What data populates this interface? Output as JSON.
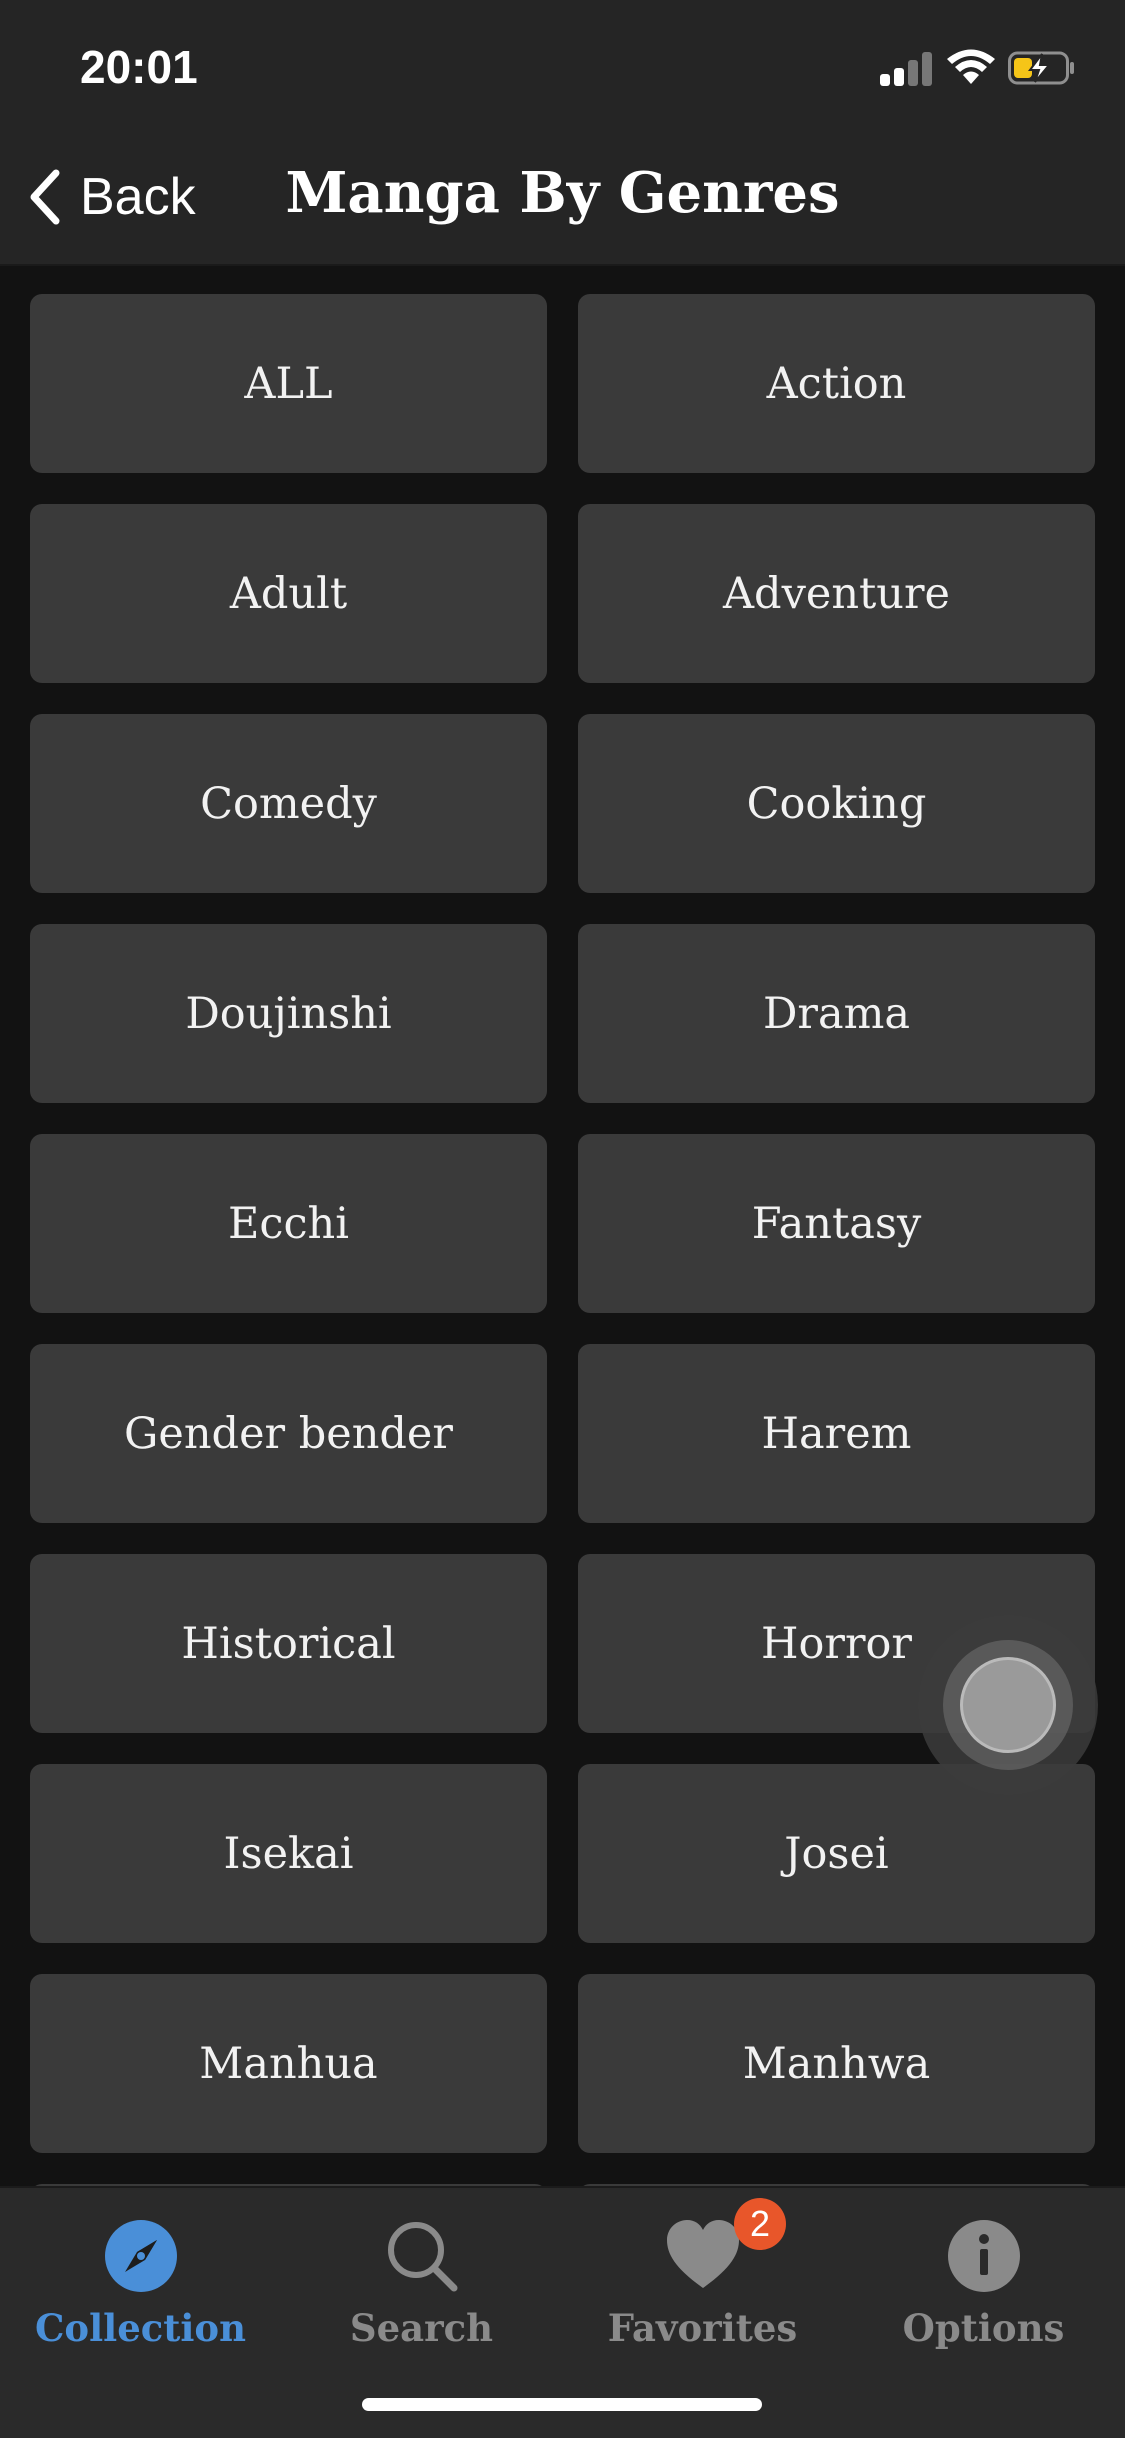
{
  "status_bar": {
    "time": "20:01"
  },
  "nav": {
    "back_label": "Back",
    "title": "Manga By Genres"
  },
  "genres": [
    "ALL",
    "Action",
    "Adult",
    "Adventure",
    "Comedy",
    "Cooking",
    "Doujinshi",
    "Drama",
    "Ecchi",
    "Fantasy",
    "Gender bender",
    "Harem",
    "Historical",
    "Horror",
    "Isekai",
    "Josei",
    "Manhua",
    "Manhwa"
  ],
  "tabs": [
    {
      "label": "Collection",
      "icon": "compass-icon",
      "active": true
    },
    {
      "label": "Search",
      "icon": "search-icon",
      "active": false
    },
    {
      "label": "Favorites",
      "icon": "heart-icon",
      "active": false
    },
    {
      "label": "Options",
      "icon": "info-icon",
      "active": false
    }
  ],
  "favorites_badge": "2",
  "colors": {
    "active": "#4a8fd8",
    "inactive": "#8a8a8a",
    "badge": "#e8562a",
    "button": "#3a3a3a",
    "background": "#121212"
  }
}
